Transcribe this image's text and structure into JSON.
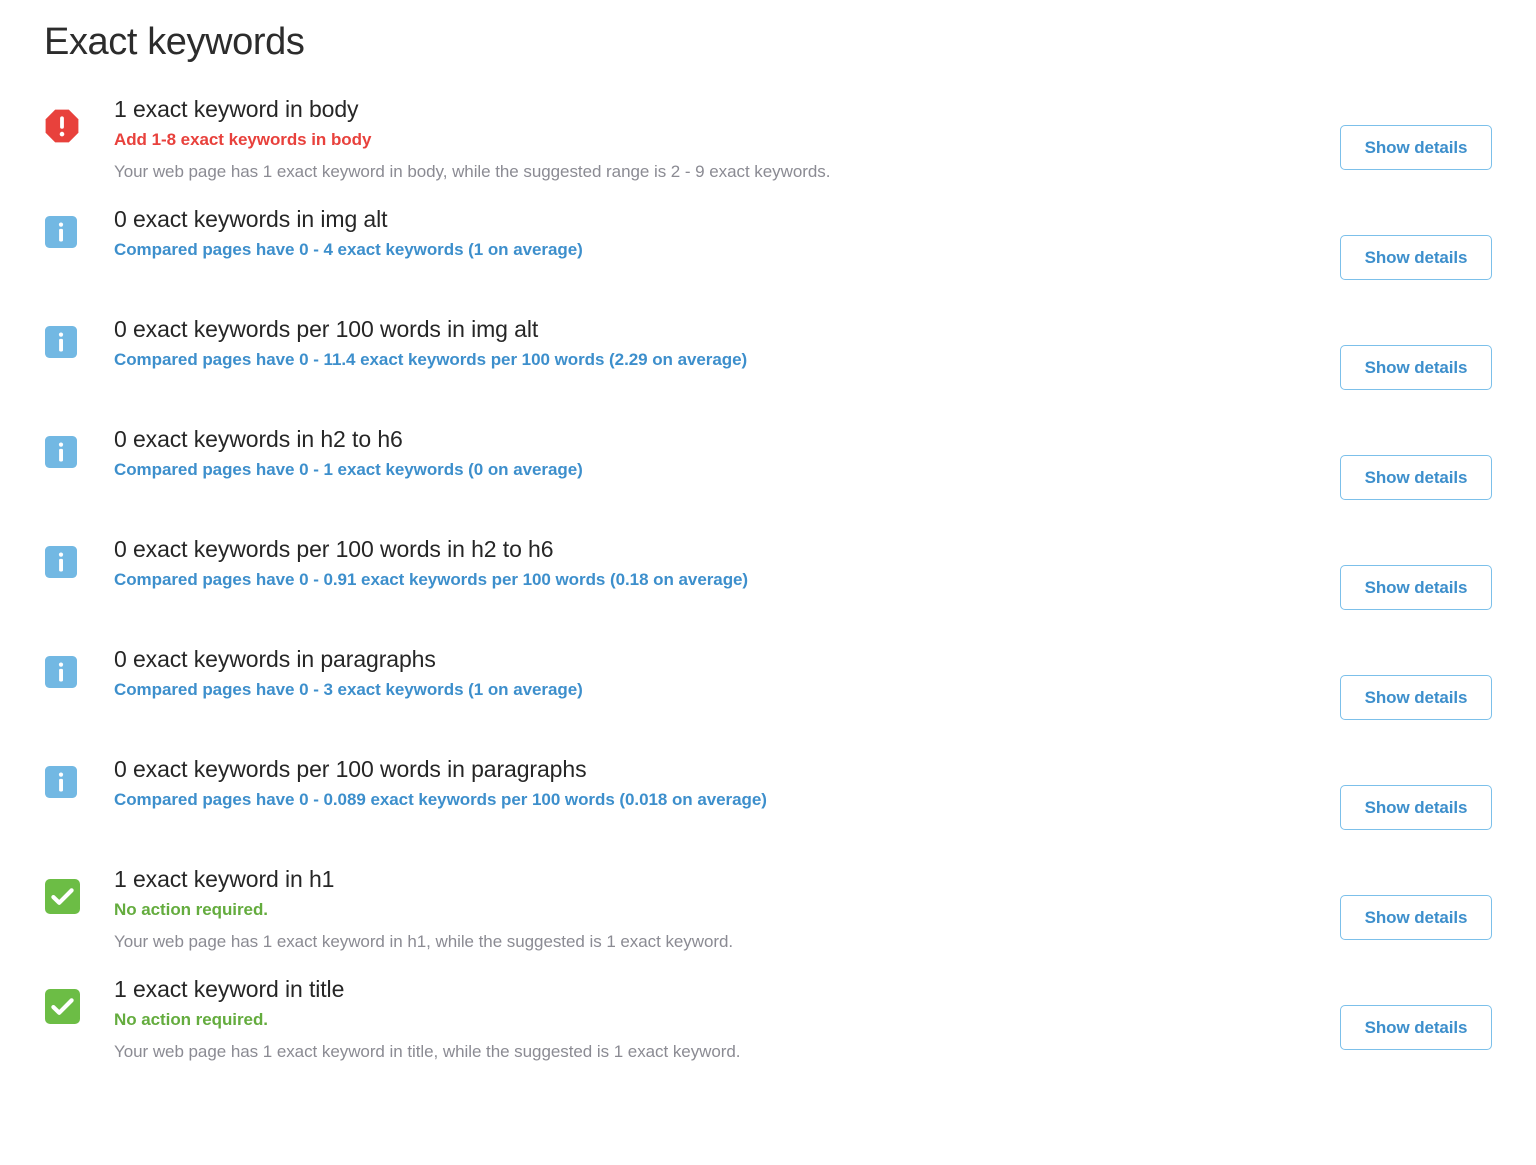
{
  "page": {
    "title": "Exact keywords",
    "details_button_label": "Show details"
  },
  "colors": {
    "error_red": "#e8413c",
    "info_blue": "#3d8fcc",
    "info_icon_blue": "#72b8e3",
    "success_green": "#6cbd45",
    "success_text_green": "#64ac3e",
    "description_grey": "#8b8b93",
    "title_black": "#262626",
    "button_border": "#7cc0ea"
  },
  "checks": [
    {
      "icon": "error-octagon-icon",
      "status_tone": "error",
      "title": "1 exact keyword in body",
      "status": "Add 1-8 exact keywords in body",
      "description": "Your web page has 1 exact keyword in body, while the suggested range is 2 - 9 exact keywords.",
      "action_label": "Show details"
    },
    {
      "icon": "info-square-icon",
      "status_tone": "info",
      "title": "0 exact keywords in img alt",
      "status": "Compared pages have 0 - 4 exact keywords (1 on average)",
      "description": "",
      "action_label": "Show details"
    },
    {
      "icon": "info-square-icon",
      "status_tone": "info",
      "title": "0 exact keywords per 100 words in img alt",
      "status": "Compared pages have 0 - 11.4 exact keywords per 100 words (2.29 on average)",
      "description": "",
      "action_label": "Show details"
    },
    {
      "icon": "info-square-icon",
      "status_tone": "info",
      "title": "0 exact keywords in h2 to h6",
      "status": "Compared pages have 0 - 1 exact keywords (0 on average)",
      "description": "",
      "action_label": "Show details"
    },
    {
      "icon": "info-square-icon",
      "status_tone": "info",
      "title": "0 exact keywords per 100 words in h2 to h6",
      "status": "Compared pages have 0 - 0.91 exact keywords per 100 words (0.18 on average)",
      "description": "",
      "action_label": "Show details"
    },
    {
      "icon": "info-square-icon",
      "status_tone": "info",
      "title": "0 exact keywords in paragraphs",
      "status": "Compared pages have 0 - 3 exact keywords (1 on average)",
      "description": "",
      "action_label": "Show details"
    },
    {
      "icon": "info-square-icon",
      "status_tone": "info",
      "title": "0 exact keywords per 100 words in paragraphs",
      "status": "Compared pages have 0 - 0.089 exact keywords per 100 words (0.018 on average)",
      "description": "",
      "action_label": "Show details"
    },
    {
      "icon": "success-check-icon",
      "status_tone": "success",
      "title": "1 exact keyword in h1",
      "status": "No action required.",
      "description": "Your web page has 1 exact keyword in h1, while the suggested is 1 exact keyword.",
      "action_label": "Show details"
    },
    {
      "icon": "success-check-icon",
      "status_tone": "success",
      "title": "1 exact keyword in title",
      "status": "No action required.",
      "description": "Your web page has 1 exact keyword in title, while the suggested is 1 exact keyword.",
      "action_label": "Show details"
    }
  ]
}
